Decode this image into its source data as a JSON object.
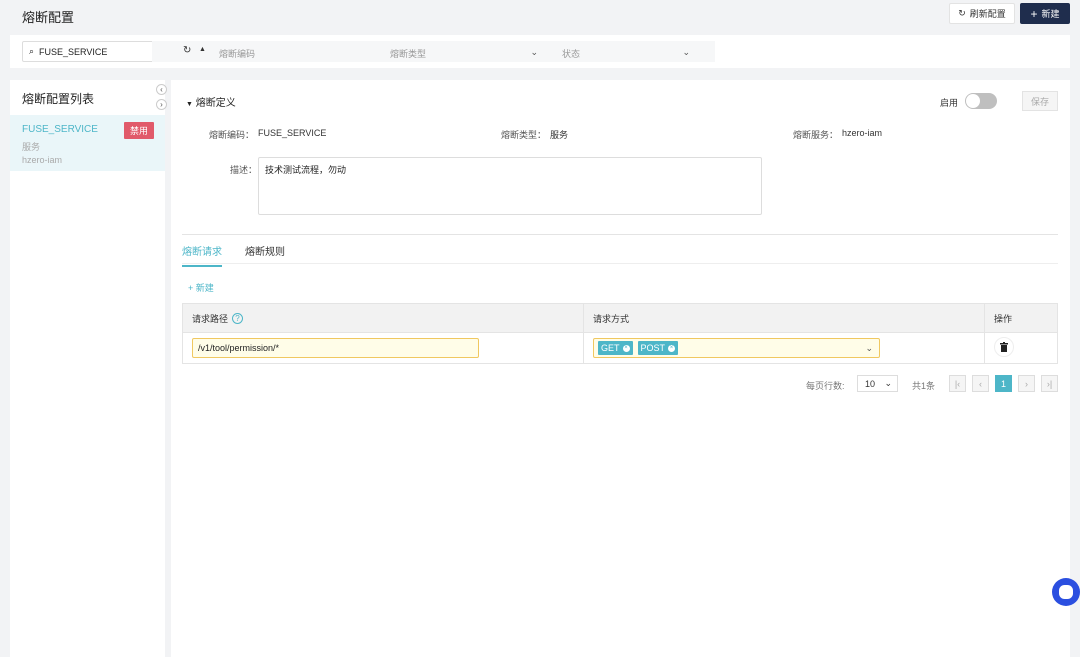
{
  "header": {
    "title": "熔断配置",
    "refresh_label": "刷新配置",
    "new_label": "新建"
  },
  "filter": {
    "search_value": "FUSE_SERVICE",
    "code_placeholder": "熔断编码",
    "type_placeholder": "熔断类型",
    "status_placeholder": "状态"
  },
  "list": {
    "title": "熔断配置列表",
    "items": [
      {
        "code": "FUSE_SERVICE",
        "badge": "禁用",
        "type": "服务",
        "service": "hzero-iam"
      }
    ]
  },
  "detail": {
    "section_title": "熔断定义",
    "enable_label": "启用",
    "enabled": false,
    "save_label": "保存",
    "code_label": "熔断编码：",
    "code_value": "FUSE_SERVICE",
    "type_label": "熔断类型：",
    "type_value": "服务",
    "service_label": "熔断服务：",
    "service_value": "hzero-iam",
    "desc_label": "描述：",
    "desc_value": "技术测试流程，勿动"
  },
  "tabs": [
    {
      "label": "熔断请求",
      "active": true
    },
    {
      "label": "熔断规则",
      "active": false
    }
  ],
  "table": {
    "new_label": "新建",
    "headers": [
      "请求路径",
      "请求方式",
      "操作"
    ],
    "rows": [
      {
        "path": "/v1/tool/permission/*",
        "methods": [
          "GET",
          "POST"
        ]
      }
    ]
  },
  "pagination": {
    "rows_label": "每页行数:",
    "page_size": "10",
    "total": "共1条",
    "current": "1"
  },
  "colors": {
    "accent": "#4db6c8",
    "primary": "#1f2d4d",
    "danger": "#e15a6a"
  }
}
